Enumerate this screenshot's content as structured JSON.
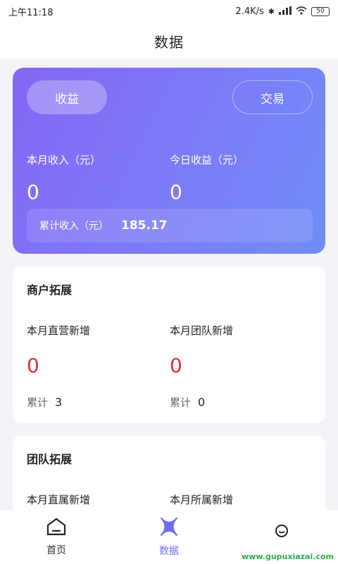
{
  "status": {
    "time": "上午11:18",
    "speed": "2.4K/s",
    "battery": "50"
  },
  "header": {
    "title": "数据"
  },
  "hero": {
    "tab_income": "收益",
    "tab_trade": "交易",
    "month_income_label": "本月收入（元）",
    "month_income_value": "0",
    "today_earnings_label": "今日收益（元）",
    "today_earnings_value": "0",
    "cumulative_label": "累计收入（元）",
    "cumulative_value": "185.17"
  },
  "merchant": {
    "title": "商户拓展",
    "direct_label": "本月直营新增",
    "direct_value": "0",
    "team_label": "本月团队新增",
    "team_value": "0",
    "total_label": "累计",
    "direct_total": "3",
    "team_total": "0"
  },
  "team": {
    "title": "团队拓展",
    "direct_label": "本月直属新增",
    "affiliate_label": "本月所属新增"
  },
  "tabbar": {
    "home": "首页",
    "data": "数据",
    "active_color": "#6b6ef0"
  },
  "watermark": "www.gupuxiazai.com"
}
